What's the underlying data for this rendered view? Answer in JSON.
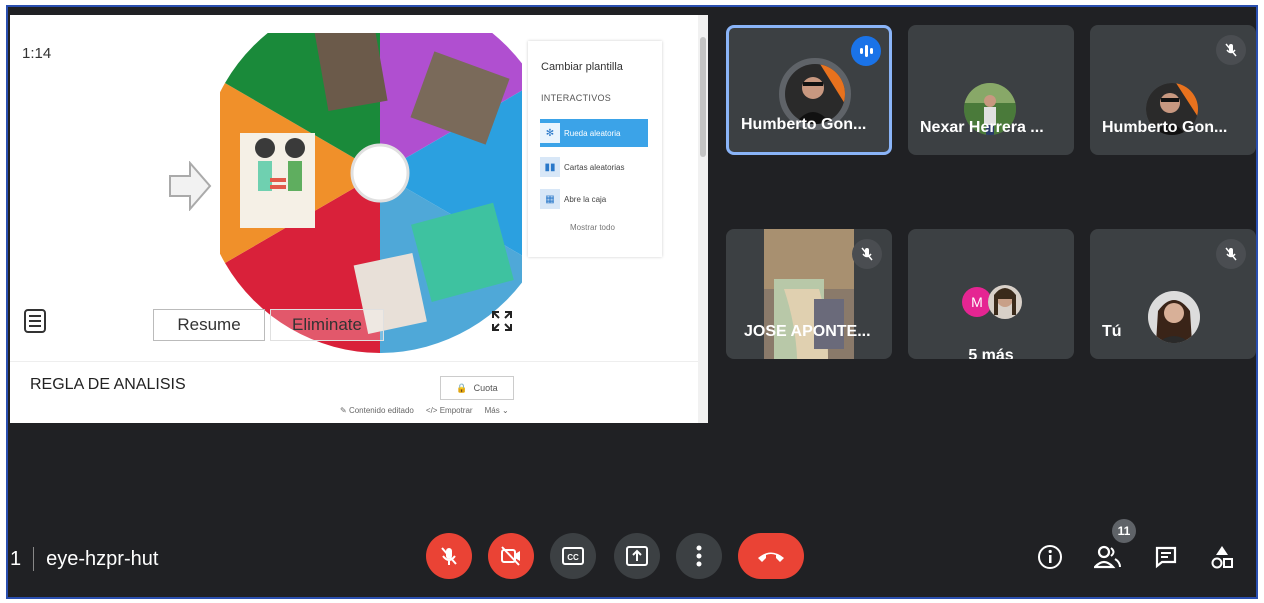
{
  "presentation": {
    "timer": "1:14",
    "resume_label": "Resume",
    "eliminate_label": "Eliminate",
    "side_panel": {
      "title": "Cambiar plantilla",
      "subtitle": "INTERACTIVOS",
      "items": [
        {
          "label": "Rueda aleatoria",
          "active": true
        },
        {
          "label": "Cartas aleatorias",
          "active": false
        },
        {
          "label": "Abre la caja",
          "active": false
        }
      ],
      "show_all": "Mostrar todo"
    },
    "activity_title": "REGLA DE ANALISIS",
    "lock_label": "Cuota",
    "meta": {
      "edited": "Contenido editado",
      "embed": "Empotrar",
      "more": "Más"
    }
  },
  "participants": [
    {
      "name": "Humberto Gon...",
      "speaking": true,
      "muted": false
    },
    {
      "name": "Nexar Herrera ...",
      "speaking": false,
      "muted": false
    },
    {
      "name": "Humberto Gon...",
      "speaking": false,
      "muted": true
    },
    {
      "name": "JOSE APONTE...",
      "speaking": false,
      "muted": true
    },
    {
      "name": "5 más",
      "avatar_letter": "M",
      "speaking": false,
      "muted": false
    },
    {
      "name": "Tú",
      "speaking": false,
      "muted": true
    }
  ],
  "meeting": {
    "time_fragment": "1",
    "code": "eye-hzpr-hut",
    "participant_count": "11"
  },
  "colors": {
    "background": "#202124",
    "tile": "#3c4043",
    "danger": "#ea4335",
    "accent": "#1a73e8",
    "speaking_outline": "#8ab4f8"
  }
}
